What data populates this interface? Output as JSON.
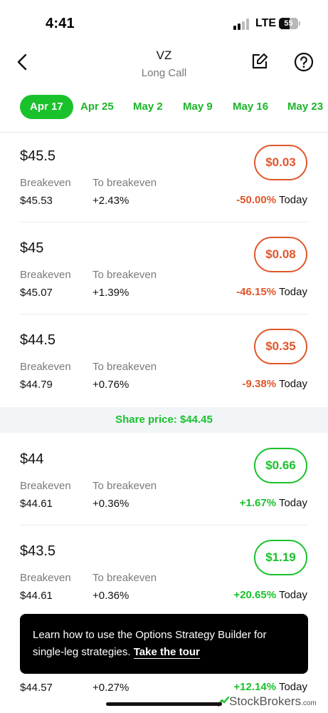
{
  "status_bar": {
    "time": "4:41",
    "network": "LTE",
    "battery": "55",
    "battery_level": 0.55
  },
  "header": {
    "title": "VZ",
    "subtitle": "Long Call"
  },
  "icons": {
    "back": "chevron-left-icon",
    "edit": "edit-icon",
    "help": "help-icon"
  },
  "date_tabs": [
    "Apr 17",
    "Apr 25",
    "May 2",
    "May 9",
    "May 16",
    "May 23"
  ],
  "active_tab": "Apr 17",
  "labels": {
    "breakeven": "Breakeven",
    "to_breakeven": "To breakeven",
    "today": "Today"
  },
  "rows": [
    {
      "strike": "$45.5",
      "breakeven": "$45.53",
      "to_breakeven": "+2.43%",
      "price": "$0.03",
      "change": "-50.00%",
      "trend": "down"
    },
    {
      "strike": "$45",
      "breakeven": "$45.07",
      "to_breakeven": "+1.39%",
      "price": "$0.08",
      "change": "-46.15%",
      "trend": "down"
    },
    {
      "strike": "$44.5",
      "breakeven": "$44.79",
      "to_breakeven": "+0.76%",
      "price": "$0.35",
      "change": "-9.38%",
      "trend": "down"
    },
    {
      "strike": "$44",
      "breakeven": "$44.61",
      "to_breakeven": "+0.36%",
      "price": "$0.66",
      "change": "+1.67%",
      "trend": "up"
    },
    {
      "strike": "$43.5",
      "breakeven": "$44.61",
      "to_breakeven": "+0.36%",
      "price": "$1.19",
      "change": "+20.65%",
      "trend": "up"
    }
  ],
  "share_price": "Share price: $44.45",
  "partial_row": {
    "breakeven": "$44.57",
    "to_breakeven": "+0.27%",
    "change": "+12.14%"
  },
  "tooltip": {
    "text": "Learn how to use the Options Strategy Builder for single-leg strategies.",
    "link": "Take the tour"
  },
  "watermark": {
    "name": "StockBrokers",
    "suffix": ".com"
  },
  "colors": {
    "green": "#19c22b",
    "red": "#e0562a",
    "muted": "#7a7a7a"
  }
}
